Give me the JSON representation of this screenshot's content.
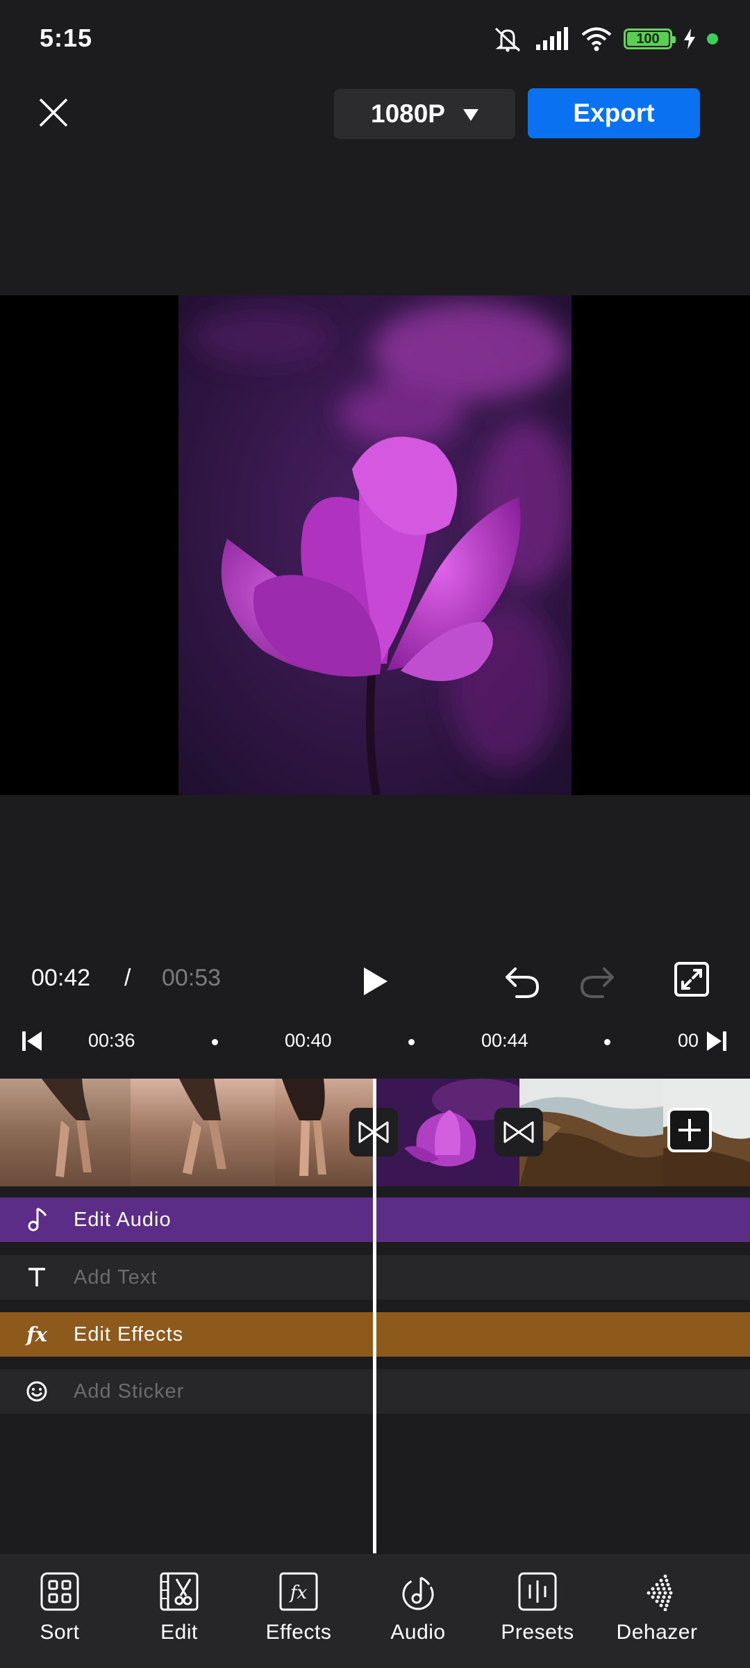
{
  "status_bar": {
    "time": "5:15",
    "battery": "100"
  },
  "top_bar": {
    "resolution": "1080P",
    "export_label": "Export"
  },
  "player": {
    "current_time": "00:42",
    "separator": "/",
    "total_time": "00:53"
  },
  "ruler": {
    "labels": [
      "00:36",
      "00:40",
      "00:44",
      "00"
    ]
  },
  "tracks": {
    "audio_label": "Edit Audio",
    "text_label": "Add Text",
    "effects_label": "Edit Effects",
    "sticker_label": "Add Sticker"
  },
  "toolbar": {
    "items": [
      {
        "label": "Sort",
        "icon": "grid-icon"
      },
      {
        "label": "Edit",
        "icon": "film-scissors-icon"
      },
      {
        "label": "Effects",
        "icon": "fx-icon"
      },
      {
        "label": "Audio",
        "icon": "music-note-icon"
      },
      {
        "label": "Presets",
        "icon": "presets-icon"
      },
      {
        "label": "Dehazer",
        "icon": "dehazer-icon"
      }
    ]
  },
  "colors": {
    "background": "#1c1c1e",
    "accent_blue": "#0a72f0",
    "audio_track": "#5b2d86",
    "effects_track": "#8d5a1c",
    "battery_green": "#5bcf52"
  }
}
